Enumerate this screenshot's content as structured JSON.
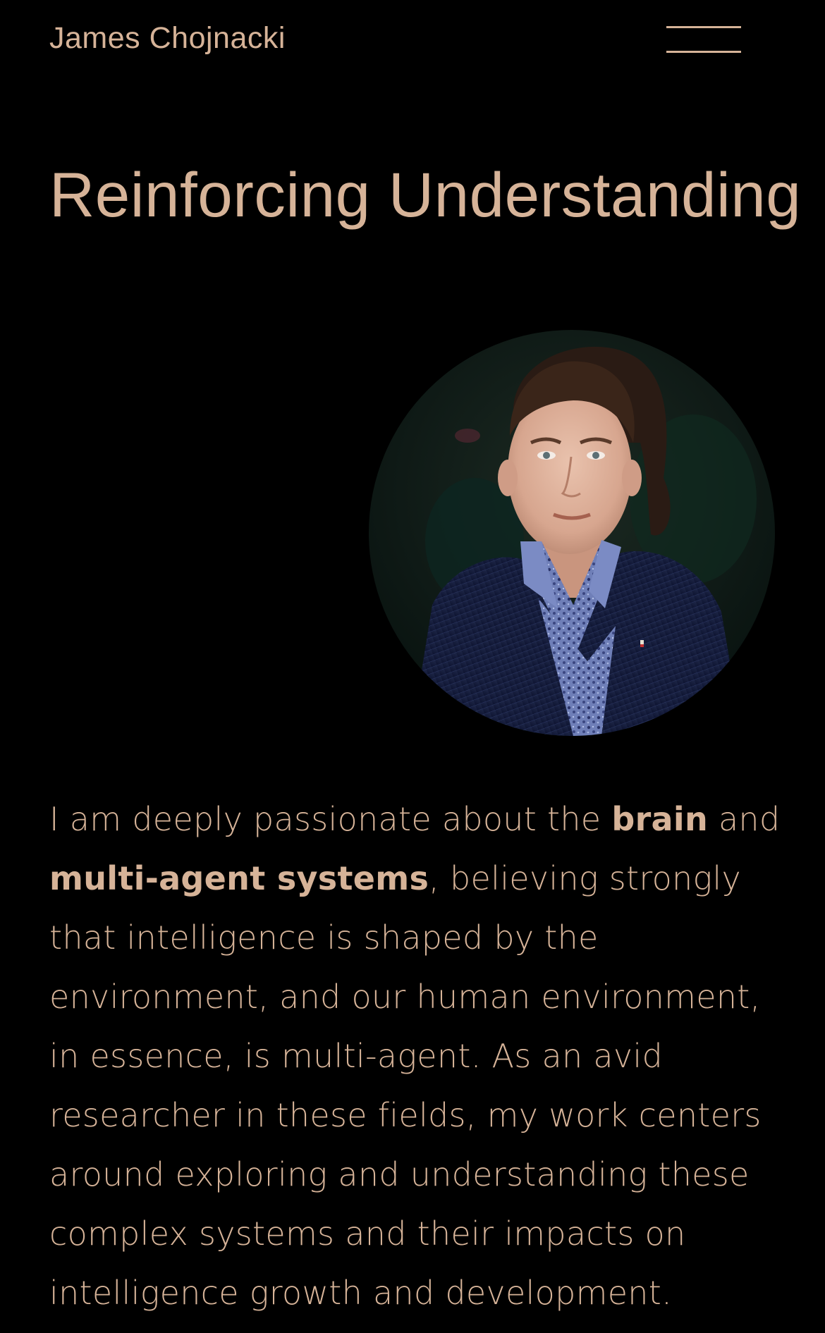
{
  "header": {
    "site_name": "James Chojnacki",
    "menu_icon": "hamburger-menu-icon"
  },
  "main": {
    "title": "Reinforcing Understanding",
    "portrait_alt": "Portrait photo",
    "intro": {
      "part1": "I am deeply passionate about the ",
      "bold1": "brain",
      "part2": " and ",
      "bold2": "multi-agent systems",
      "part3": ", believing strongly that intelligence is shaped by the environment, and our human environment, in essence, is multi-agent. As an avid researcher in these fields, my work centers around exploring and understanding these complex systems and their impacts on intelligence growth and development."
    }
  },
  "colors": {
    "background": "#000000",
    "accent": "#d6b398"
  }
}
